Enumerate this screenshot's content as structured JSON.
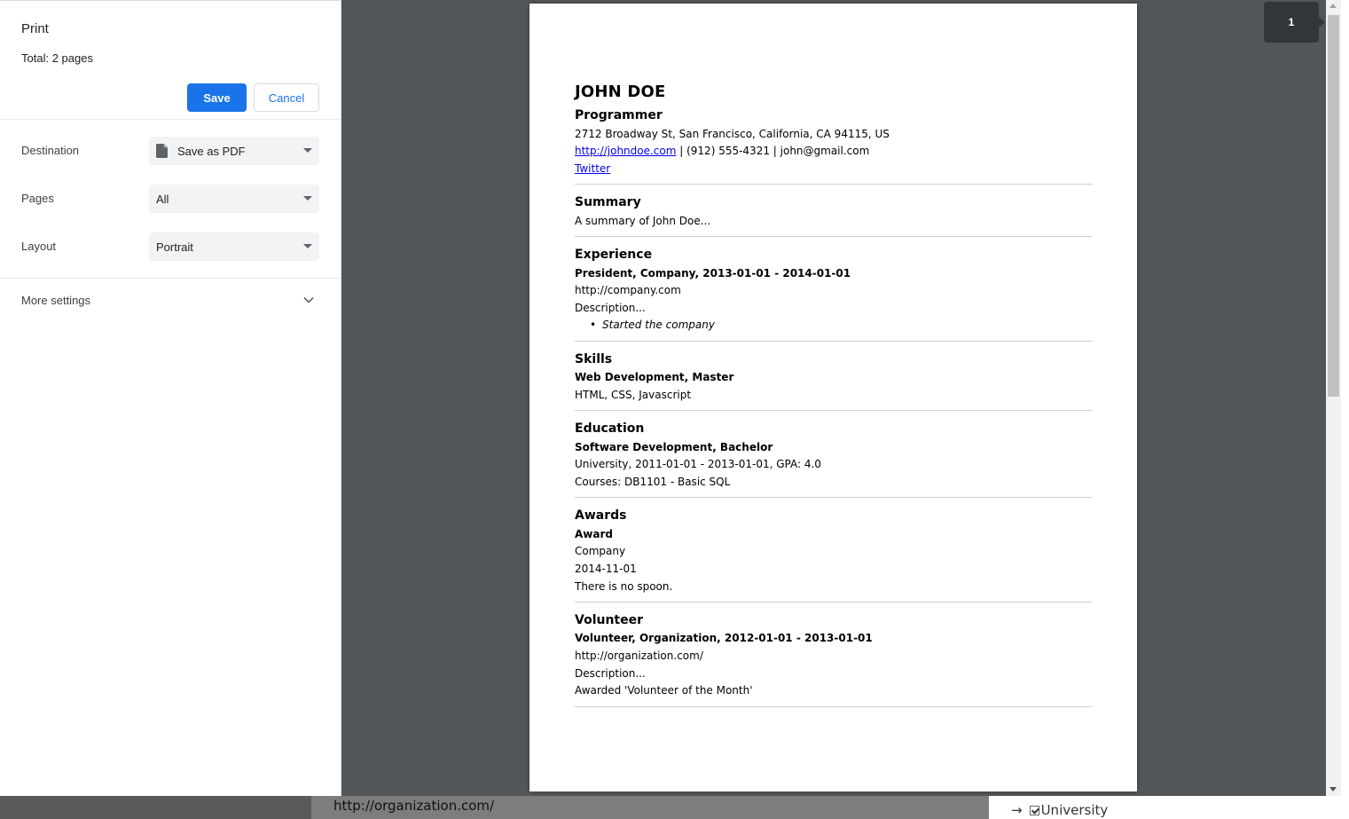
{
  "print_panel": {
    "title": "Print",
    "total_prefix": "Total: ",
    "total_pages": "2 pages",
    "save_label": "Save",
    "cancel_label": "Cancel",
    "destination_label": "Destination",
    "destination_value": "Save as PDF",
    "pages_label": "Pages",
    "pages_value": "All",
    "layout_label": "Layout",
    "layout_value": "Portrait",
    "more_settings_label": "More settings"
  },
  "page_indicator": "1",
  "resume": {
    "name": "JOHN DOE",
    "role": "Programmer",
    "address": "2712 Broadway St, San Francisco, California, CA 94115, US",
    "website": "http://johndoe.com",
    "contact_rest": " | (912) 555-4321 | john@gmail.com",
    "profile_link": "Twitter",
    "summary": {
      "heading": "Summary",
      "text": "A summary of John Doe..."
    },
    "experience": {
      "heading": "Experience",
      "title": "President, Company, 2013-01-01 - 2014-01-01",
      "url": "http://company.com",
      "description": "Description...",
      "highlight": "Started the company"
    },
    "skills": {
      "heading": "Skills",
      "title": "Web Development, Master",
      "keywords": "HTML, CSS, Javascript"
    },
    "education": {
      "heading": "Education",
      "title": "Software Development, Bachelor",
      "details": "University, 2011-01-01 - 2013-01-01, GPA: 4.0",
      "courses": "Courses: DB1101 - Basic SQL"
    },
    "awards": {
      "heading": "Awards",
      "title": "Award",
      "awarder": "Company",
      "date": "2014-11-01",
      "summary": "There is no spoon."
    },
    "volunteer": {
      "heading": "Volunteer",
      "title": "Volunteer, Organization, 2012-01-01 - 2013-01-01",
      "url": "http://organization.com/",
      "description": "Description...",
      "highlight": "Awarded 'Volunteer of the Month'"
    }
  },
  "underlying_page": {
    "url_text": "http://organization.com/",
    "arrow": "→",
    "checkbox_label": "University"
  },
  "colors": {
    "accent": "#1a73e8",
    "preview_background": "#535659",
    "badge": "#323639"
  }
}
